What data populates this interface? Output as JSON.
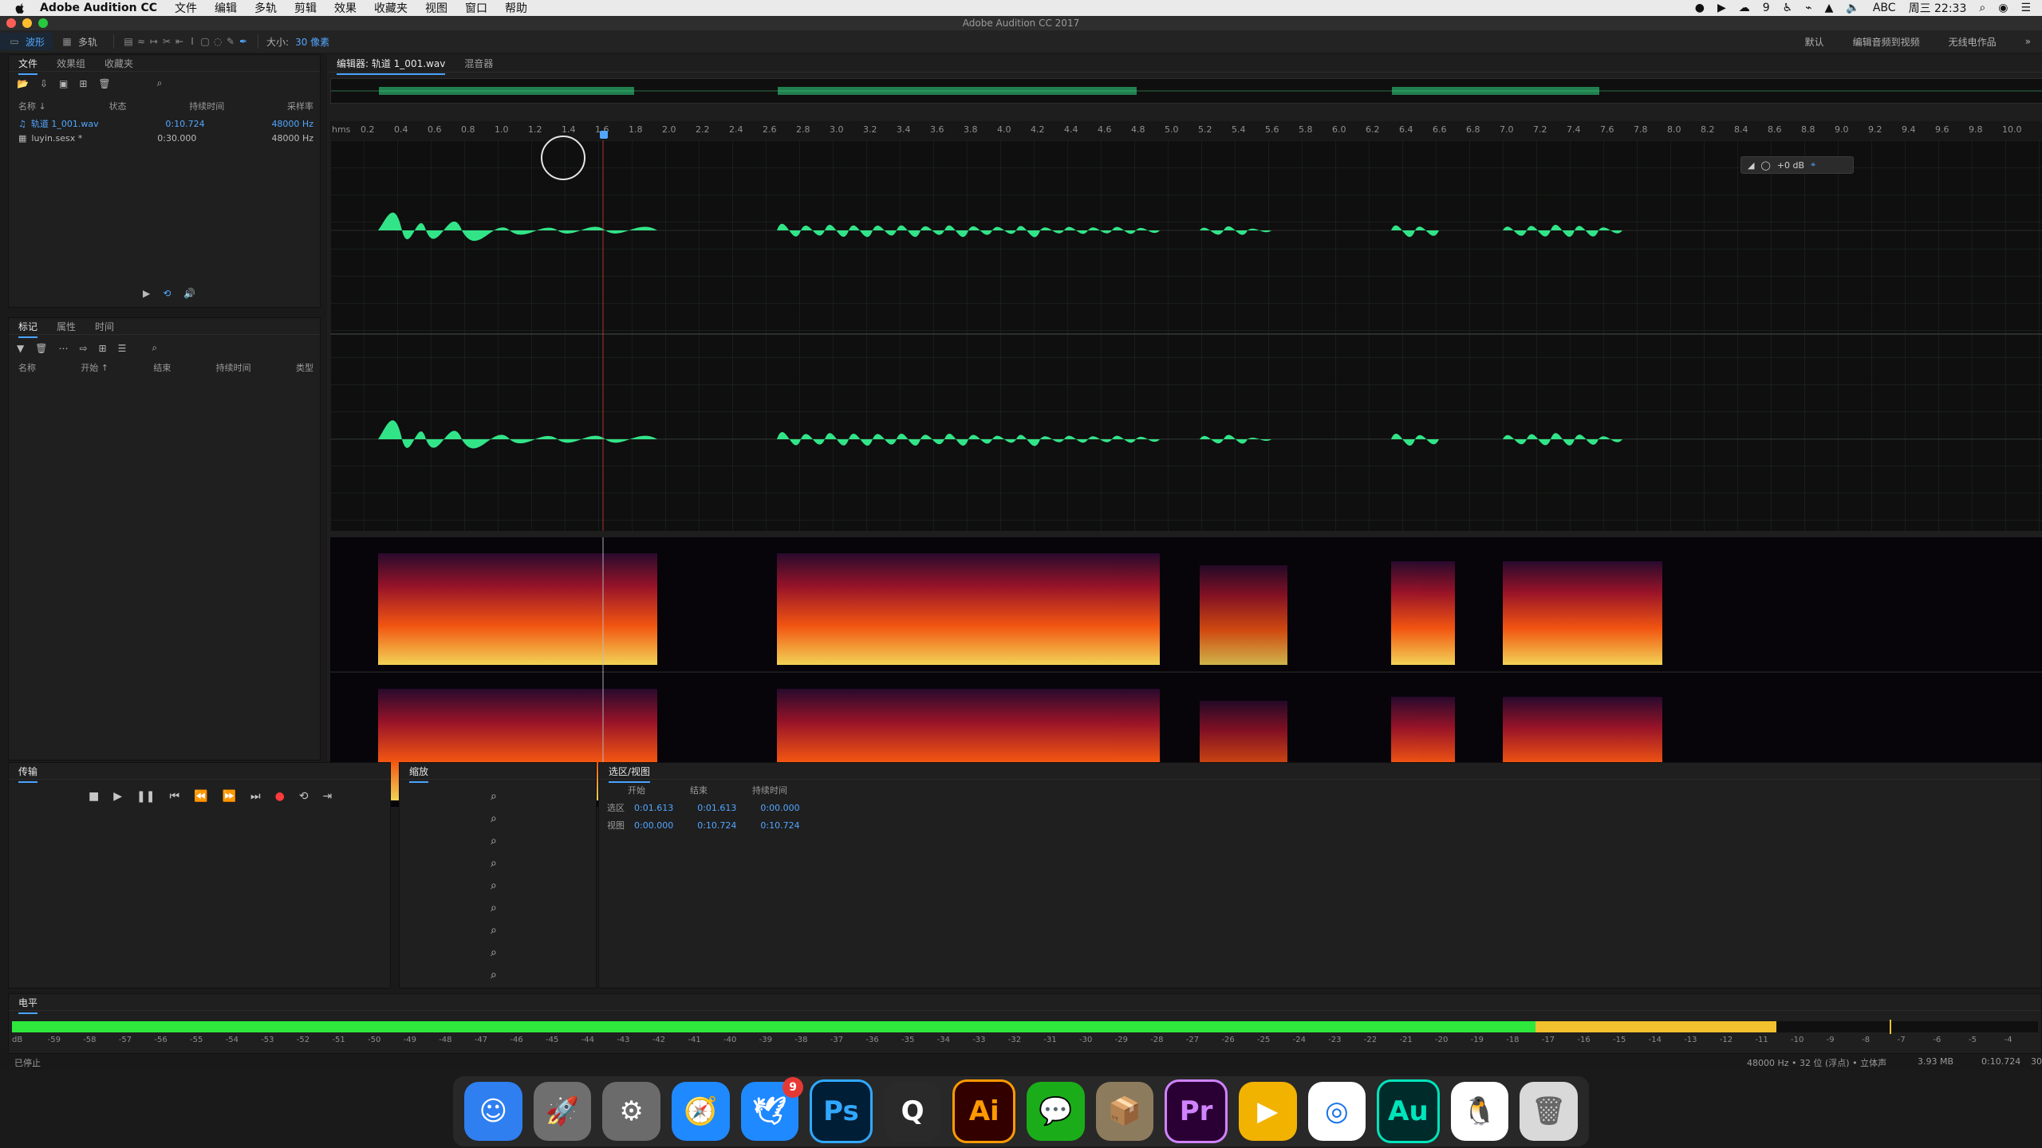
{
  "menubar": {
    "app_name": "Adobe Audition CC",
    "items": [
      "文件",
      "编辑",
      "多轨",
      "剪辑",
      "效果",
      "收藏夹",
      "视图",
      "窗口",
      "帮助"
    ],
    "status": {
      "abc": "ABC",
      "time": "周三 22:33",
      "badge_count": "9"
    }
  },
  "window": {
    "title": "Adobe Audition CC 2017"
  },
  "toolbar": {
    "mode_waveform": "波形",
    "mode_multitrack": "多轨",
    "size_label": "大小:",
    "size_value": "30 像素",
    "right_items": [
      "默认",
      "编辑音频到视频",
      "无线电作品"
    ]
  },
  "files_panel": {
    "tabs": [
      "文件",
      "效果组",
      "收藏夹"
    ],
    "columns": {
      "name": "名称 ↓",
      "status": "状态",
      "duration": "持续时间",
      "samplerate": "采样率"
    },
    "items": [
      {
        "name": "轨道 1_001.wav",
        "duration": "0:10.724",
        "samplerate": "48000 Hz"
      },
      {
        "name": "luyin.sesx *",
        "duration": "0:30.000",
        "samplerate": "48000 Hz"
      }
    ]
  },
  "markers_panel": {
    "tabs": [
      "标记",
      "属性",
      "时间"
    ],
    "columns": {
      "name": "名称",
      "start": "开始 ↑",
      "end": "结束",
      "duration": "持续时间",
      "type": "类型"
    }
  },
  "editor": {
    "tab_title": "编辑器: 轨道 1_001.wav",
    "tab_mixer": "混音器",
    "gain": "+0 dB",
    "timeline": {
      "unit": "hms",
      "labels": [
        "0.2",
        "0.4",
        "0.6",
        "0.8",
        "1.0",
        "1.2",
        "1.4",
        "1.6",
        "1.8",
        "2.0",
        "2.2",
        "2.4",
        "2.6",
        "2.8",
        "3.0",
        "3.2",
        "3.4",
        "3.6",
        "3.8",
        "4.0",
        "4.2",
        "4.4",
        "4.6",
        "4.8",
        "5.0",
        "5.2",
        "5.4",
        "5.6",
        "5.8",
        "6.0",
        "6.2",
        "6.4",
        "6.6",
        "6.8",
        "7.0",
        "7.2",
        "7.4",
        "7.6",
        "7.8",
        "8.0",
        "8.2",
        "8.4",
        "8.6",
        "8.8",
        "9.0",
        "9.2",
        "9.4",
        "9.6",
        "9.8",
        "10.0"
      ]
    }
  },
  "transport_panel": {
    "title": "传输"
  },
  "zoom_panel": {
    "title": "缩放"
  },
  "selection_panel": {
    "title": "选区/视图",
    "headers": {
      "start": "开始",
      "end": "结束",
      "duration": "持续时间"
    },
    "rows": [
      {
        "label": "选区",
        "start": "0:01.613",
        "end": "0:01.613",
        "duration": "0:00.000"
      },
      {
        "label": "视图",
        "start": "0:00.000",
        "end": "0:10.724",
        "duration": "0:10.724"
      }
    ]
  },
  "levels_panel": {
    "title": "电平",
    "ticks": [
      "dB",
      "-59",
      "-58",
      "-57",
      "-56",
      "-55",
      "-54",
      "-53",
      "-52",
      "-51",
      "-50",
      "-49",
      "-48",
      "-47",
      "-46",
      "-45",
      "-44",
      "-43",
      "-42",
      "-41",
      "-40",
      "-39",
      "-38",
      "-37",
      "-36",
      "-35",
      "-34",
      "-33",
      "-32",
      "-31",
      "-30",
      "-29",
      "-28",
      "-27",
      "-26",
      "-25",
      "-24",
      "-23",
      "-22",
      "-21",
      "-20",
      "-19",
      "-18",
      "-17",
      "-16",
      "-15",
      "-14",
      "-13",
      "-12",
      "-11",
      "-10",
      "-9",
      "-8",
      "-7",
      "-6",
      "-5",
      "-4"
    ]
  },
  "statusbar": {
    "left": "已停止",
    "format": "48000 Hz • 32 位 (浮点) • 立体声",
    "size": "3.93 MB",
    "duration": "0:10.724",
    "trailing": "30"
  },
  "dock": {
    "apps": [
      {
        "name": "finder",
        "label": ""
      },
      {
        "name": "launchpad",
        "label": ""
      },
      {
        "name": "system-preferences",
        "label": ""
      },
      {
        "name": "safari",
        "label": ""
      },
      {
        "name": "feishu",
        "label": ""
      },
      {
        "name": "photoshop",
        "label": "Ps"
      },
      {
        "name": "quicktime",
        "label": ""
      },
      {
        "name": "illustrator",
        "label": "Ai"
      },
      {
        "name": "wechat",
        "label": ""
      },
      {
        "name": "archive-utility",
        "label": ""
      },
      {
        "name": "premiere",
        "label": "Pr"
      },
      {
        "name": "keynote",
        "label": ""
      },
      {
        "name": "chrome",
        "label": ""
      },
      {
        "name": "audition",
        "label": "Au"
      },
      {
        "name": "qq",
        "label": ""
      },
      {
        "name": "trash",
        "label": ""
      }
    ]
  }
}
